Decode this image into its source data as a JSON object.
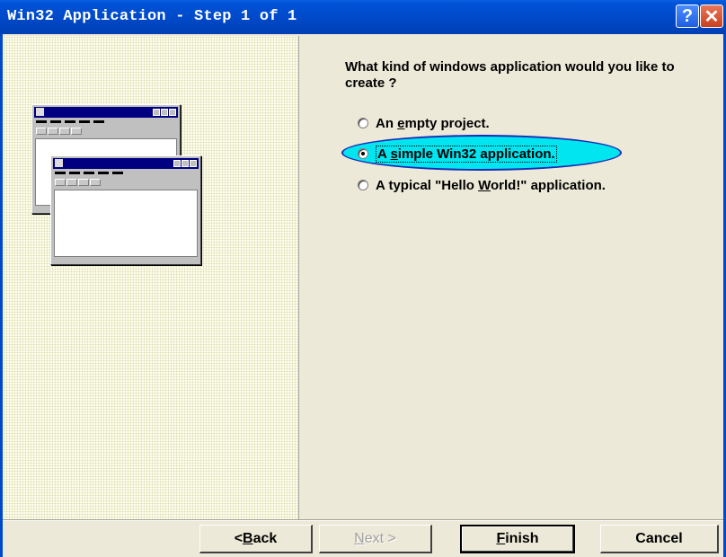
{
  "window": {
    "title": "Win32 Application - Step 1 of 1",
    "help_label": "?",
    "close_label": "✕"
  },
  "wizard": {
    "question": "What kind of windows application would you like to create ?",
    "options": [
      {
        "prefix": "An ",
        "accel": "e",
        "suffix": "mpty project.",
        "selected": false
      },
      {
        "prefix": "A ",
        "accel": "s",
        "suffix": "imple Win32 application.",
        "selected": true
      },
      {
        "prefix": "A typical \"Hello ",
        "accel": "W",
        "suffix": "orld!\"  application.",
        "selected": false
      }
    ],
    "highlight_color": "#00e5ef"
  },
  "buttons": {
    "back": {
      "prefix": "< ",
      "accel": "B",
      "suffix": "ack"
    },
    "next": {
      "prefix": "",
      "accel": "N",
      "suffix": "ext >"
    },
    "finish": {
      "prefix": "",
      "accel": "F",
      "suffix": "inish"
    },
    "cancel": "Cancel"
  },
  "illustration": {
    "icon": "window-preview-icon"
  }
}
